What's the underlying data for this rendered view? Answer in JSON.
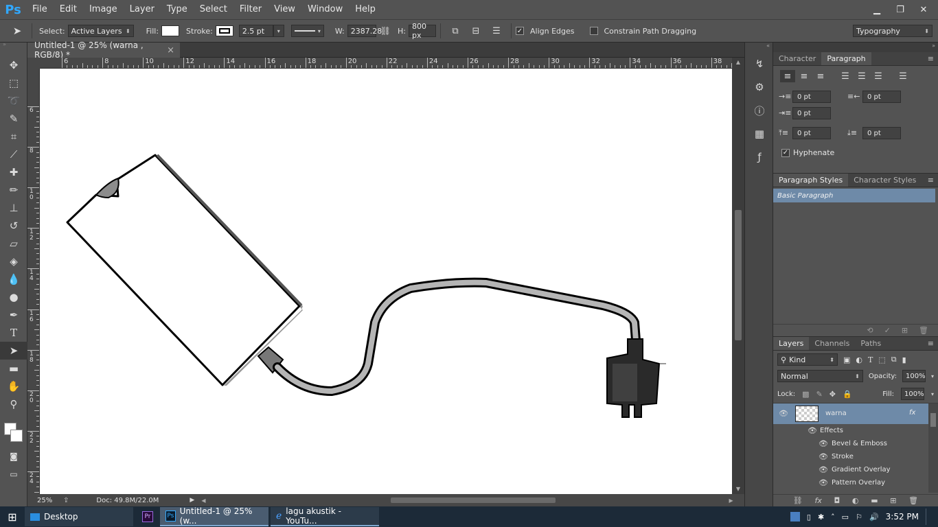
{
  "menubar": {
    "logo": "Ps",
    "items": [
      "File",
      "Edit",
      "Image",
      "Layer",
      "Type",
      "Select",
      "Filter",
      "View",
      "Window",
      "Help"
    ],
    "window_buttons": [
      "▁",
      "❐",
      "✕"
    ]
  },
  "options": {
    "select_label": "Select:",
    "select_value": "Active Layers",
    "fill_label": "Fill:",
    "stroke_label": "Stroke:",
    "stroke_size": "2.5 pt",
    "w_label": "W:",
    "w_value": "2387.28",
    "h_label": "H:",
    "h_value": "800 px",
    "align_edges": "Align Edges",
    "constrain_path": "Constrain Path Dragging",
    "workspace": "Typography"
  },
  "document": {
    "tab_title": "Untitled-1 @ 25% (warna , RGB/8) *",
    "close": "×",
    "ruler_top": [
      "6",
      "8",
      "10",
      "12",
      "14",
      "16",
      "18",
      "20",
      "22",
      "24",
      "26",
      "28",
      "30",
      "32",
      "34",
      "36",
      "38"
    ],
    "ruler_left": [
      "6",
      "8",
      "1 0",
      "1 2",
      "1 4",
      "1 6",
      "1 8",
      "2 0",
      "2 2",
      "2 4"
    ]
  },
  "status": {
    "zoom": "25%",
    "doc": "Doc: 49.8M/22.0M"
  },
  "character_panel": {
    "tabs": [
      "Character",
      "Paragraph"
    ],
    "indent_left": "0 pt",
    "indent_right": "0 pt",
    "indent_first": "0 pt",
    "space_before": "0 pt",
    "space_after": "0 pt",
    "hyphenate": "Hyphenate"
  },
  "para_styles_panel": {
    "tabs": [
      "Paragraph Styles",
      "Character Styles"
    ],
    "selected": "Basic Paragraph"
  },
  "layers_panel": {
    "tabs": [
      "Layers",
      "Channels",
      "Paths"
    ],
    "filter": "Kind",
    "blend": "Normal",
    "opacity_label": "Opacity:",
    "opacity": "100%",
    "lock_label": "Lock:",
    "fill_label": "Fill:",
    "fill": "100%",
    "layer_name": "warna",
    "fx": "fx",
    "effects_label": "Effects",
    "effects": [
      "Bevel & Emboss",
      "Stroke",
      "Gradient Overlay",
      "Pattern Overlay"
    ]
  },
  "taskbar": {
    "desktop": "Desktop",
    "ps_app": "Untitled-1 @ 25% (w...",
    "ie_app": "lagu akustik - YouTu...",
    "time": "3:52 PM"
  },
  "colors": {
    "accent": "#31a8ff",
    "selected_row": "#6e8aa8",
    "panel_bg": "#535353"
  }
}
